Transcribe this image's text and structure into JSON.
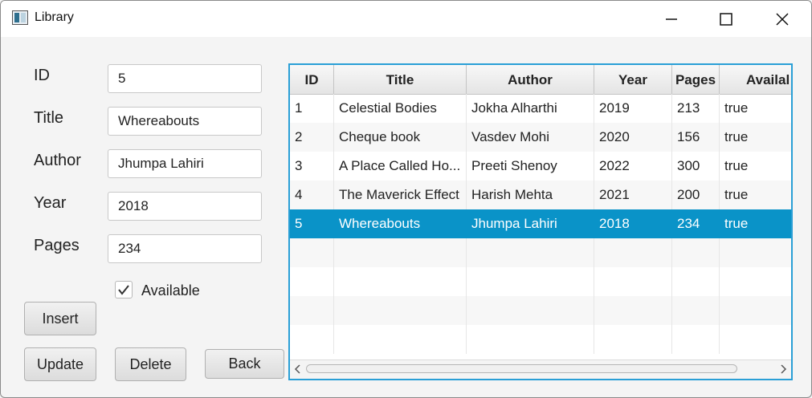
{
  "window": {
    "title": "Library"
  },
  "form": {
    "id_label": "ID",
    "id_value": "5",
    "title_label": "Title",
    "title_value": "Whereabouts",
    "author_label": "Author",
    "author_value": "Jhumpa Lahiri",
    "year_label": "Year",
    "year_value": "2018",
    "pages_label": "Pages",
    "pages_value": "234",
    "available_label": "Available",
    "available_checked": true
  },
  "buttons": {
    "insert": "Insert",
    "update": "Update",
    "delete": "Delete",
    "back": "Back"
  },
  "table": {
    "columns": [
      "ID",
      "Title",
      "Author",
      "Year",
      "Pages",
      "Availal"
    ],
    "rows": [
      [
        "1",
        "Celestial Bodies",
        "Jokha Alharthi",
        "2019",
        "213",
        "true"
      ],
      [
        "2",
        "Cheque book",
        "Vasdev Mohi",
        "2020",
        "156",
        "true"
      ],
      [
        "3",
        "A Place Called Ho...",
        "Preeti Shenoy",
        "2022",
        "300",
        "true"
      ],
      [
        "4",
        "The Maverick Effect",
        "Harish Mehta",
        "2021",
        "200",
        "true"
      ],
      [
        "5",
        "Whereabouts",
        "Jhumpa Lahiri",
        "2018",
        "234",
        "true"
      ]
    ],
    "selected_row": 4
  },
  "colors": {
    "accent": "#2a9fd6",
    "selection": "#0a93c8"
  }
}
